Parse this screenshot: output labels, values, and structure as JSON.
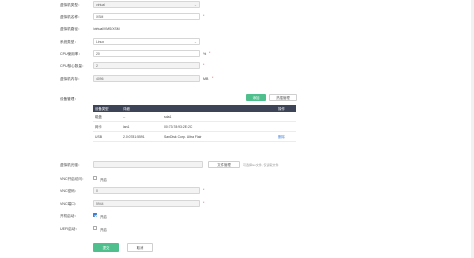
{
  "form": {
    "vm_type": {
      "label": "虚拟机类型：",
      "value": "virtual"
    },
    "vm_name": {
      "label": "虚拟机名称：",
      "value": "XSM",
      "required": "*"
    },
    "vm_path": {
      "label": "虚拟机路径：",
      "value": "/virtual/VMS/XSM"
    },
    "os_type": {
      "label": "系统类型：",
      "value": "Linux"
    },
    "cpu_usage": {
      "label": "CPU使用率：",
      "value": "20",
      "unit": "%",
      "required": "*"
    },
    "cpu_cores": {
      "label": "CPU核心数量：",
      "value": "2",
      "required": "*"
    },
    "memory": {
      "label": "虚拟机内存：",
      "value": "4096",
      "unit": "MB",
      "required": "*"
    },
    "devices": {
      "label": "设备管理：",
      "add_button": "添加",
      "hotplug_button": "热插管理",
      "columns": [
        "设备类型",
        "详细",
        "",
        "操作"
      ],
      "rows": [
        {
          "type": "磁盘",
          "detail": "--",
          "extra": "sda1",
          "action": ""
        },
        {
          "type": "网卡",
          "detail": "lan1",
          "extra": "00:73:78:93:2E:2C",
          "action": ""
        },
        {
          "type": "USB",
          "detail": "2.0:0781:5591",
          "extra": "SanDisk Corp. Ultra Flair",
          "action": "删除"
        }
      ]
    },
    "vm_disk": {
      "label": "虚拟机光驱：",
      "value": "",
      "button": "文件管理",
      "hint": "可选择iso文件, 仅读取文件"
    },
    "vnc_enable": {
      "label": "VNC开启访问：",
      "option": "开启",
      "checked": false
    },
    "vnc_password": {
      "label": "VNC密码：",
      "value": "0",
      "required": "*"
    },
    "vnc_port": {
      "label": "VNC端口：",
      "value": "5944",
      "required": "*"
    },
    "autostart": {
      "label": "开机启动：",
      "option": "开启",
      "checked": true
    },
    "uefi": {
      "label": "UEFI启动：",
      "option": "开启",
      "checked": false
    },
    "submit_button": "提交",
    "cancel_button": "取消"
  }
}
